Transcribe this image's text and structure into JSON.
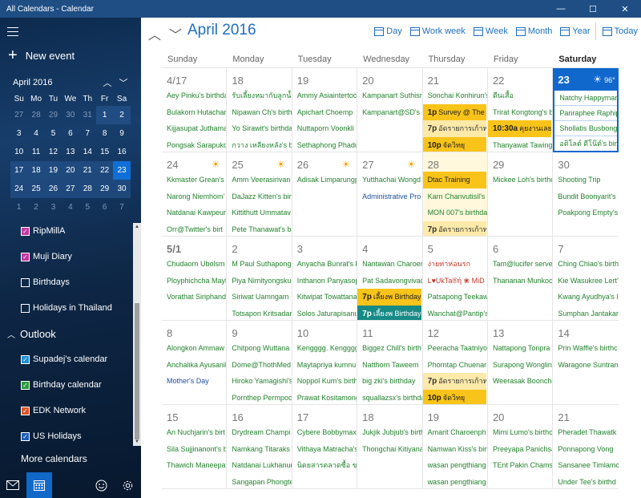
{
  "window": {
    "title": "All Calendars - Calendar",
    "controls": [
      "—",
      "☐",
      "✕"
    ]
  },
  "sidebar": {
    "new_event": "New event",
    "mini_month": "April 2016",
    "mini_dows": [
      "Su",
      "Mo",
      "Tu",
      "We",
      "Th",
      "Fr",
      "Sa"
    ],
    "mini_weeks": [
      [
        "27",
        "28",
        "29",
        "30",
        "31",
        "1",
        "2"
      ],
      [
        "3",
        "4",
        "5",
        "6",
        "7",
        "8",
        "9"
      ],
      [
        "10",
        "11",
        "12",
        "13",
        "14",
        "15",
        "16"
      ],
      [
        "17",
        "18",
        "19",
        "20",
        "21",
        "22",
        "23"
      ],
      [
        "24",
        "25",
        "26",
        "27",
        "28",
        "29",
        "30"
      ],
      [
        "1",
        "2",
        "3",
        "4",
        "5",
        "6",
        "7"
      ]
    ],
    "calendars": [
      {
        "name": "RipMillA",
        "color": "#c2369f",
        "checked": true
      },
      {
        "name": "Muji Diary",
        "color": "#c2369f",
        "checked": true
      },
      {
        "name": "Birthdays",
        "color": "#ffffff",
        "checked": false
      },
      {
        "name": "Holidays in Thailand",
        "color": "#ffffff",
        "checked": false
      }
    ],
    "account": "Outlook",
    "account_calendars": [
      {
        "name": "Supadej's calendar",
        "color": "#1d8fd1",
        "checked": true
      },
      {
        "name": "Birthday calendar",
        "color": "#2e9a3c",
        "checked": true
      },
      {
        "name": "EDK Network",
        "color": "#d9542a",
        "checked": true
      },
      {
        "name": "US Holidays",
        "color": "#1d5fb4",
        "checked": true
      }
    ],
    "more_calendars": "More calendars"
  },
  "header": {
    "month_title": "April 2016",
    "views": [
      "Day",
      "Work week",
      "Week",
      "Month",
      "Year",
      "Today"
    ]
  },
  "weekdays": [
    "Sunday",
    "Monday",
    "Tuesday",
    "Wednesday",
    "Thursday",
    "Friday",
    "Saturday"
  ],
  "weeks": [
    [
      {
        "num": "4/17",
        "events": [
          {
            "t": "Aey Pinku's birthda"
          },
          {
            "t": "Bulakorn Hutachar"
          },
          {
            "t": "Kijjasupat Juthama"
          },
          {
            "t": "Pongsak Sarapukd"
          }
        ]
      },
      {
        "num": "18",
        "events": [
          {
            "t": "รับเลี้ยงหมากับลูกน้ำ"
          },
          {
            "t": "Nipawan Ch's birth"
          },
          {
            "t": "Yo Sirawit's birthda"
          },
          {
            "t": "กวาง เหลียงหลัง's birt"
          }
        ]
      },
      {
        "num": "19",
        "events": [
          {
            "t": "Ammy Asiaintertoc"
          },
          {
            "t": "Apichart Choemp"
          },
          {
            "t": "Nuttaporn Voonkli"
          },
          {
            "t": "Sethaphong Phadu"
          }
        ]
      },
      {
        "num": "20",
        "events": [
          {
            "t": "Kampanart Suthisr"
          },
          {
            "t": "Kampanart@SD's l"
          }
        ]
      },
      {
        "num": "21",
        "events": [
          {
            "t": "Sonchai Konhirun's"
          },
          {
            "s": "yellow",
            "time": "1p",
            "t": "Survey @ The '"
          },
          {
            "s": "yellow2",
            "time": "7p",
            "t": "อัดรายการเก้าหน้า"
          },
          {
            "s": "yellow",
            "time": "10p",
            "t": "จัดวิทยุ"
          }
        ]
      },
      {
        "num": "22",
        "events": [
          {
            "t": "ดีนเสื้อ"
          },
          {
            "t": "Trirat Kongtong's b"
          },
          {
            "s": "yellow",
            "time": "10:30a",
            "t": "คุยงานเลยงาน"
          },
          {
            "t": "Thanyawat Tawing"
          }
        ]
      },
      {
        "num": "23",
        "today": true,
        "weather": "96°",
        "events": [
          {
            "t": "Natchy Happyman"
          },
          {
            "t": "Panraphee Raphip"
          },
          {
            "t": "Shollatis Busbong'"
          },
          {
            "t": "อติโลต์ ดีโน๊ต์'s birt"
          }
        ]
      }
    ],
    [
      {
        "num": "24",
        "sun": true,
        "events": [
          {
            "t": "Kkmaster Grean's l"
          },
          {
            "t": "Narong Niemhom'"
          },
          {
            "t": "Natdanai Kawpeur"
          },
          {
            "t": "Orr@Twitter's birt"
          }
        ]
      },
      {
        "num": "25",
        "sun": true,
        "events": [
          {
            "t": "Amm Veerasirivan"
          },
          {
            "t": "DaJazz Kitten's birt"
          },
          {
            "t": "Kittithutt Ummatav"
          },
          {
            "t": "Pete Thanawat's bi"
          }
        ]
      },
      {
        "num": "26",
        "sun": true,
        "events": [
          {
            "t": "Adisak Limparungp"
          }
        ]
      },
      {
        "num": "27",
        "sun": true,
        "events": [
          {
            "t": "Yutthachai Wongd"
          },
          {
            "s": "blue",
            "t": "Administrative Pro"
          }
        ]
      },
      {
        "num": "28",
        "highlight": true,
        "events": [
          {
            "s": "yellow",
            "t": "Dtac Training"
          },
          {
            "t": "Karn Chanvutisil's l"
          },
          {
            "t": "MON 007's birthda"
          },
          {
            "s": "yellow2",
            "time": "7p",
            "t": "อัดรายการเก้าหน้า"
          }
        ]
      },
      {
        "num": "29",
        "events": [
          {
            "t": "Mickee Loh's birthc"
          }
        ]
      },
      {
        "num": "30",
        "events": [
          {
            "t": "Shooting Trip"
          },
          {
            "t": "Bundit Boonyarit's"
          },
          {
            "t": "Poakpong Empty's"
          }
        ]
      }
    ],
    [
      {
        "num": "5/1",
        "bold": true,
        "events": [
          {
            "t": "Chudaorn Ubolsm"
          },
          {
            "t": "Ployphichcha Mayl"
          },
          {
            "t": "Vorathat Siriphand"
          }
        ]
      },
      {
        "num": "2",
        "events": [
          {
            "t": "M Paul Suthapong"
          },
          {
            "t": "Piya Nimityongsku"
          },
          {
            "t": "Siriwat Uamngam"
          },
          {
            "t": "Totsapon Kritsadar"
          }
        ]
      },
      {
        "num": "3",
        "events": [
          {
            "t": "Anyacha Bunrat's b"
          },
          {
            "t": "Inthanon Panyasop"
          },
          {
            "t": "Kitwipat Towattana"
          },
          {
            "t": "Solos Jaturapisanu"
          }
        ]
      },
      {
        "num": "4",
        "events": [
          {
            "t": "Nantawan Charoer"
          },
          {
            "t": "Pat Sadavongvivad"
          },
          {
            "s": "yellow",
            "time": "7p",
            "t": "เลี้ยงพ Birthday"
          },
          {
            "s": "teal",
            "time": "7p",
            "t": "เลี้ยงพ Birthday"
          }
        ]
      },
      {
        "num": "5",
        "events": [
          {
            "s": "red",
            "t": "ง่ายท่าห่อนรก"
          },
          {
            "s": "red",
            "t": "L♥UkTa®ή ❀ MiD"
          },
          {
            "t": "Patsapong Teekaw"
          },
          {
            "t": "Wanchat@Pantip's"
          }
        ]
      },
      {
        "num": "6",
        "events": [
          {
            "t": "Tam@lucifer serve"
          },
          {
            "t": "Thananan Munkoc"
          }
        ]
      },
      {
        "num": "7",
        "events": [
          {
            "t": "Ching Chiao's birth"
          },
          {
            "t": "Kie Wasukree Lert'"
          },
          {
            "t": "Kwang Ayudhya's l"
          },
          {
            "t": "Sumphan Jantakar"
          }
        ]
      }
    ],
    [
      {
        "num": "8",
        "events": [
          {
            "t": "Alongkon Ammaw"
          },
          {
            "t": "Anchalika Ayusanil"
          },
          {
            "s": "blue",
            "t": "Mother's Day"
          }
        ]
      },
      {
        "num": "9",
        "events": [
          {
            "t": "Chitpong Wuttana"
          },
          {
            "t": "Dome@ThothMed"
          },
          {
            "t": "Hiroko Yamagishi's"
          },
          {
            "t": "Pornthep Permpoc"
          }
        ]
      },
      {
        "num": "10",
        "events": [
          {
            "t": "Kengggg. Kengggg"
          },
          {
            "t": "Maytapriya kumnu"
          },
          {
            "t": "Noppol Kum's birth"
          },
          {
            "t": "Prawat Kositamong"
          }
        ]
      },
      {
        "num": "11",
        "events": [
          {
            "t": "Biggez Chill's birth"
          },
          {
            "t": "Natthorn Taweem"
          },
          {
            "t": "big zki's birthday"
          },
          {
            "t": "squallazsx's birthda"
          }
        ]
      },
      {
        "num": "12",
        "events": [
          {
            "t": "Peeracha Taatniyor"
          },
          {
            "t": "Phorntap Chuenar"
          },
          {
            "s": "yellow2",
            "time": "7p",
            "t": "อัดรายการเก้าหน้า"
          },
          {
            "s": "yellow",
            "time": "10p",
            "t": "จัดวิทยุ"
          }
        ]
      },
      {
        "num": "13",
        "events": [
          {
            "t": "Nattapong Tonpra"
          },
          {
            "t": "Surapong Wonglin"
          },
          {
            "t": "Weerasak Boonchu"
          }
        ]
      },
      {
        "num": "14",
        "events": [
          {
            "t": "Prin Waffle's birthc"
          },
          {
            "t": "Waragone Suntran"
          }
        ]
      }
    ],
    [
      {
        "num": "15",
        "events": [
          {
            "t": "An Nuchjarin's birt"
          },
          {
            "t": "Sila Sujjinanont's b"
          },
          {
            "t": "Thawich Maneepai"
          }
        ]
      },
      {
        "num": "16",
        "events": [
          {
            "t": "Drydream Champi"
          },
          {
            "t": "Namkang Titaraks"
          },
          {
            "t": "Natdanai Lukhanur"
          },
          {
            "t": "Sangapan Phongte"
          }
        ]
      },
      {
        "num": "17",
        "events": [
          {
            "t": "Cybere Bobbymax"
          },
          {
            "t": "Vithaya Matracha's"
          },
          {
            "t": "นิตยสารตลาดซื้อ ขาย"
          }
        ]
      },
      {
        "num": "18",
        "events": [
          {
            "t": "Jukjik Jubjub's birth"
          },
          {
            "t": "Thongchai Kitiyana"
          }
        ]
      },
      {
        "num": "19",
        "events": [
          {
            "t": "Amarit Charoenph"
          },
          {
            "t": "Namwan Kiss's birt"
          },
          {
            "t": "wasan pengthiang"
          },
          {
            "t": "wasan pengthiang"
          }
        ]
      },
      {
        "num": "20",
        "events": [
          {
            "t": "Mimi Lumo's birthc"
          },
          {
            "t": "Preeyapa Panichsa"
          },
          {
            "t": "TEnt Pakin Chamsr"
          }
        ]
      },
      {
        "num": "21",
        "events": [
          {
            "t": "Pheradet Thawatk"
          },
          {
            "t": "Ponnapong Vong"
          },
          {
            "t": "Sansanee Timlamc"
          },
          {
            "t": "Under Tee's birthd"
          }
        ]
      }
    ]
  ]
}
